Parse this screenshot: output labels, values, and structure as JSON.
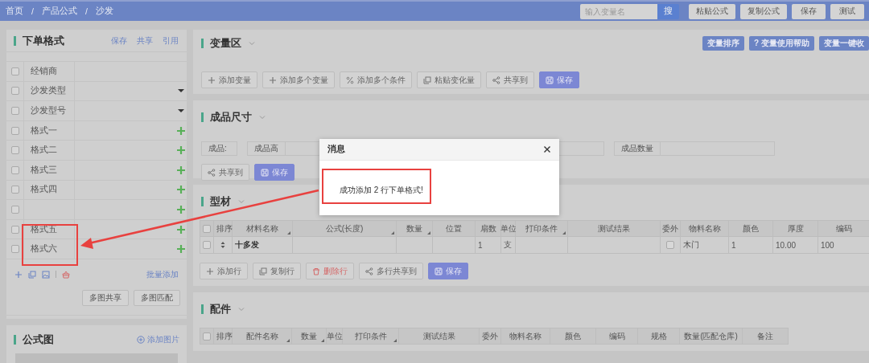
{
  "breadcrumb": [
    {
      "label": "首页",
      "separator": "/"
    },
    {
      "label": "产品公式",
      "separator": "/"
    },
    {
      "label": "沙发"
    }
  ],
  "search": {
    "placeholder": "输入变量名",
    "button": "搜"
  },
  "top_buttons": [
    "粘贴公式",
    "复制公式",
    "保存",
    "测试"
  ],
  "order_format": {
    "title": "下单格式",
    "actions": [
      "保存",
      "共享",
      "引用"
    ],
    "rows": [
      {
        "label": "经销商",
        "checked": false,
        "kind": "text"
      },
      {
        "label": "沙发类型",
        "checked": false,
        "kind": "select"
      },
      {
        "label": "沙发型号",
        "checked": false,
        "kind": "select"
      },
      {
        "label": "格式一",
        "checked": false,
        "kind": "add"
      },
      {
        "label": "格式二",
        "checked": false,
        "kind": "add"
      },
      {
        "label": "格式三",
        "checked": false,
        "kind": "add"
      },
      {
        "label": "格式四",
        "checked": false,
        "kind": "add"
      },
      {
        "checked": false,
        "kind": "add"
      },
      {
        "label": "格式五",
        "checked": false,
        "kind": "add"
      },
      {
        "label": "格式六",
        "checked": false,
        "kind": "add"
      }
    ],
    "batch_add": "批量添加",
    "buttons": [
      "多图共享",
      "多图匹配"
    ]
  },
  "formula_image": {
    "title": "公式图",
    "add": "添加图片"
  },
  "variables": {
    "title": "变量区",
    "header_buttons": [
      "变量排序",
      "? 变量使用帮助",
      "变量一键收"
    ],
    "toolbar": [
      {
        "label": "添加变量",
        "kind": "default"
      },
      {
        "label": "添加多个变量",
        "kind": "default"
      },
      {
        "label": "添加多个条件",
        "kind": "default"
      },
      {
        "label": "粘贴变化量",
        "kind": "default"
      },
      {
        "label": "共享到",
        "kind": "default"
      },
      {
        "label": "保存",
        "kind": "primary"
      }
    ]
  },
  "size": {
    "title": "成品尺寸",
    "fields": [
      {
        "kind": "label",
        "label": "成品:"
      },
      {
        "kind": "input",
        "label": "成品高"
      },
      {
        "kind": "input"
      },
      {
        "kind": "input",
        "label": "成品数量"
      }
    ],
    "toolbar": [
      {
        "label": "共享到",
        "kind": "default"
      },
      {
        "label": "保存",
        "kind": "primary"
      }
    ]
  },
  "profiles": {
    "title": "型材",
    "all_checked": false,
    "columns": [
      {
        "label": "排序",
        "kind": "sort",
        "sortable": false
      },
      {
        "label": "材料名称",
        "kind": "name",
        "sortable": true
      },
      {
        "label": "公式(长度)",
        "kind": "text",
        "sortable": true
      },
      {
        "label": "数量",
        "kind": "text",
        "sortable": true
      },
      {
        "label": "位置",
        "kind": "text",
        "sortable": false
      },
      {
        "label": "扇数",
        "kind": "text",
        "sortable": false
      },
      {
        "label": "单位",
        "kind": "text",
        "sortable": false
      },
      {
        "label": "打印条件",
        "kind": "text",
        "sortable": true
      },
      {
        "label": "测试结果",
        "kind": "text",
        "sortable": false
      },
      {
        "label": "委外",
        "kind": "check",
        "sortable": false
      },
      {
        "label": "物料名称",
        "kind": "text",
        "sortable": false
      },
      {
        "label": "颜色",
        "kind": "text",
        "sortable": false
      },
      {
        "label": "厚度",
        "kind": "text",
        "sortable": false
      },
      {
        "label": "编码",
        "kind": "text",
        "sortable": false
      }
    ],
    "rows": [
      {
        "checked": false,
        "cells": [
          null,
          "十多发",
          null,
          null,
          null,
          "1",
          "支",
          null,
          null,
          false,
          "木门",
          "1",
          "10.00",
          "100"
        ]
      }
    ],
    "toolbar": [
      {
        "label": "添加行",
        "kind": "default"
      },
      {
        "label": "复制行",
        "kind": "default"
      },
      {
        "label": "删除行",
        "kind": "danger"
      },
      {
        "label": "多行共享到",
        "kind": "default"
      },
      {
        "label": "保存",
        "kind": "primary"
      }
    ]
  },
  "parts": {
    "title": "配件",
    "all_checked": false,
    "columns": [
      {
        "label": "排序",
        "kind": "sort",
        "sortable": false
      },
      {
        "label": "配件名称",
        "kind": "text",
        "sortable": true
      },
      {
        "label": "数量",
        "kind": "text",
        "sortable": true
      },
      {
        "label": "单位",
        "kind": "text",
        "sortable": false
      },
      {
        "label": "打印条件",
        "kind": "text",
        "sortable": true
      },
      {
        "label": "测试结果",
        "kind": "text",
        "sortable": false
      },
      {
        "label": "委外",
        "kind": "check",
        "sortable": false
      },
      {
        "label": "物料名称",
        "kind": "text",
        "sortable": false
      },
      {
        "label": "颜色",
        "kind": "text",
        "sortable": false
      },
      {
        "label": "编码",
        "kind": "text",
        "sortable": false
      },
      {
        "label": "规格",
        "kind": "text",
        "sortable": false
      },
      {
        "label": "数量(匹配仓库)",
        "kind": "text",
        "sortable": false
      },
      {
        "label": "备注",
        "kind": "text",
        "sortable": false
      }
    ]
  },
  "dialog": {
    "title": "消息",
    "message": "成功添加 2 行下单格式!"
  }
}
